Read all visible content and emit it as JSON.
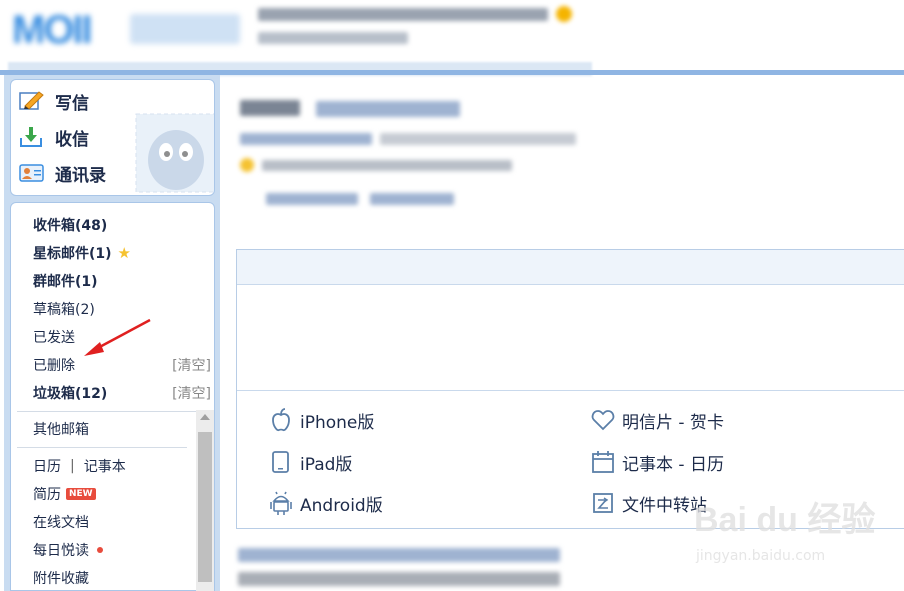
{
  "quick_actions": [
    {
      "label": "写信",
      "icon": "compose-icon"
    },
    {
      "label": "收信",
      "icon": "receive-icon"
    },
    {
      "label": "通讯录",
      "icon": "contacts-icon"
    }
  ],
  "folders": {
    "inbox": "收件箱(48)",
    "starred": "星标邮件(1)",
    "group": "群邮件(1)",
    "drafts": "草稿箱(2)",
    "sent": "已发送",
    "deleted": "已删除",
    "deleted_clear": "[清空]",
    "spam": "垃圾箱(12)",
    "spam_clear": "[清空]",
    "other": "其他邮箱"
  },
  "tools": {
    "calendar": "日历",
    "divider": "|",
    "notebook": "记事本",
    "resume": "简历",
    "resume_badge": "NEW",
    "docs": "在线文档",
    "daily": "每日悦读",
    "attachments": "附件收藏"
  },
  "apps": {
    "iphone": "iPhone版",
    "ipad": "iPad版",
    "android": "Android版",
    "postcard": "明信片 - 贺卡",
    "notebook_cal": "记事本 - 日历",
    "transfer": "文件中转站"
  },
  "watermark": {
    "brand": "Bai du 经验",
    "url": "jingyan.baidu.com"
  },
  "colors": {
    "accent": "#8fb5e3",
    "sidebar_bg": "#c9dcf1",
    "annotation_arrow": "#e02020",
    "badge_red": "#e84c3d",
    "star": "#f5c230"
  }
}
